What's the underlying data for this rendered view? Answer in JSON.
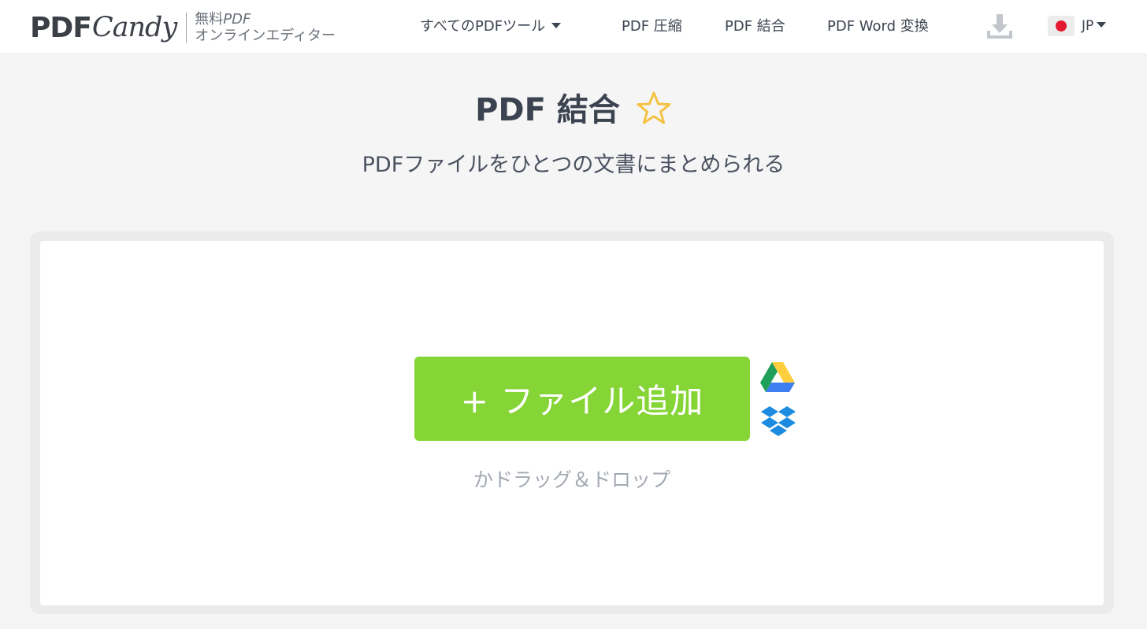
{
  "header": {
    "logo_main": "PDF",
    "logo_script": "Candy",
    "tagline_line1_prefix": "無料",
    "tagline_line1_suffix": "PDF",
    "tagline_line2": "オンラインエディター",
    "nav": {
      "all_tools": "すべてのPDFツール",
      "compress": "PDF 圧縮",
      "merge": "PDF 結合",
      "pdf_to_word": "PDF Word 変換"
    },
    "download_icon": "download-icon",
    "language": {
      "code": "JP",
      "flag": "japan-flag-icon"
    }
  },
  "main": {
    "title": "PDF 結合",
    "favorite_icon": "star-outline-icon",
    "subtitle": "PDFファイルをひとつの文書にまとめられる"
  },
  "upload": {
    "add_button_label": "+ ファイル追加",
    "drop_hint": "かドラッグ＆ドロップ",
    "cloud_sources": [
      "google-drive-icon",
      "dropbox-icon"
    ]
  },
  "colors": {
    "accent_green": "#86d537",
    "star_yellow": "#f5c242",
    "flag_red": "#e3192f",
    "text_dark": "#3b4350",
    "background": "#f5f5f5"
  }
}
